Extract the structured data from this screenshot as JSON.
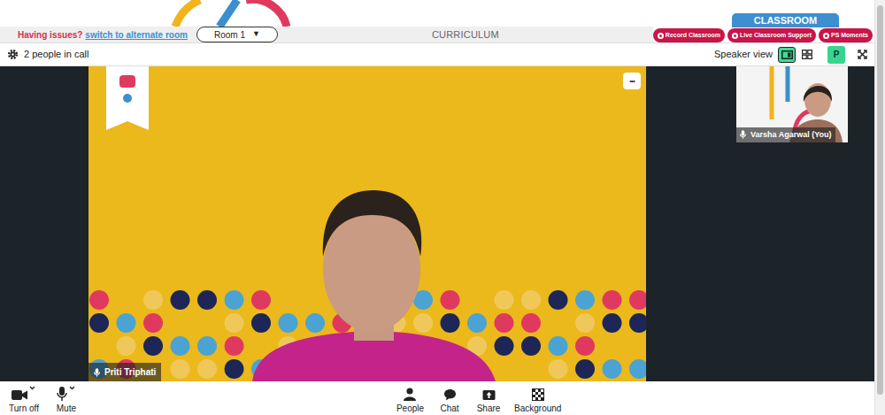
{
  "header": {
    "classroom_tab": "CLASSROOM",
    "actions": [
      "Record Classroom",
      "Live Classroom Support",
      "PS Moments"
    ]
  },
  "room_bar": {
    "issue_text": "Having issues?",
    "switch_link": "switch to alternate room",
    "room_select": "Room 1",
    "room_caret": "▼",
    "curriculum": "CURRICULUM"
  },
  "call_bar": {
    "people_count": "2 people in call",
    "view_label": "Speaker view",
    "views": [
      {
        "kind": "speaker",
        "selected": true
      },
      {
        "kind": "grid",
        "selected": false
      }
    ],
    "avatar": "P"
  },
  "participants": [
    {
      "name": "Priti Triphati",
      "kind": "main"
    },
    {
      "name": "Varsha Agarwal (You)",
      "kind": "self"
    }
  ],
  "more_button": "•••",
  "toolbar": {
    "left": [
      {
        "label": "Turn off",
        "kind": "camera"
      },
      {
        "label": "Mute",
        "kind": "mic"
      }
    ],
    "center": [
      {
        "label": "People",
        "kind": "people"
      },
      {
        "label": "Chat",
        "kind": "chat"
      },
      {
        "label": "Share",
        "kind": "share"
      },
      {
        "label": "Background",
        "kind": "background"
      }
    ]
  }
}
